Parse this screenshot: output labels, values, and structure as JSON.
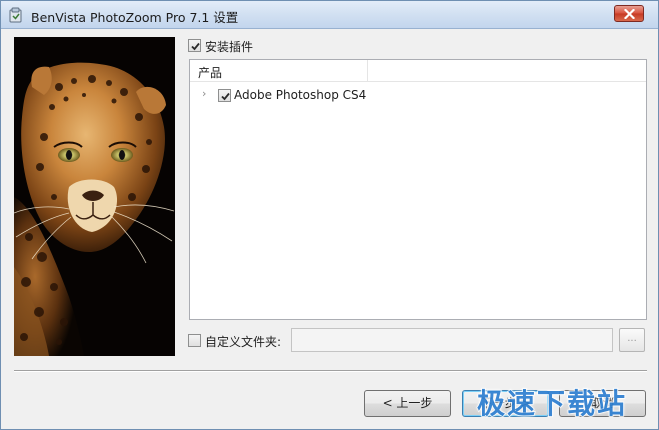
{
  "window": {
    "title": "BenVista PhotoZoom Pro 7.1 设置",
    "app_icon": "installer-icon",
    "close_icon": "close-icon"
  },
  "install_plugins": {
    "label": "安装插件",
    "checked": true
  },
  "product_list": {
    "column_header": "产品",
    "items": [
      {
        "label": "Adobe Photoshop CS4",
        "checked": true,
        "expander_icon": "chevron-right-icon"
      }
    ]
  },
  "custom_folder": {
    "label": "自定义文件夹:",
    "checked": false,
    "value": "",
    "browse_label": "..."
  },
  "buttons": {
    "back": "< 上一步",
    "next": "下一步 >",
    "cancel": "取消"
  },
  "watermark": "极速下载站"
}
